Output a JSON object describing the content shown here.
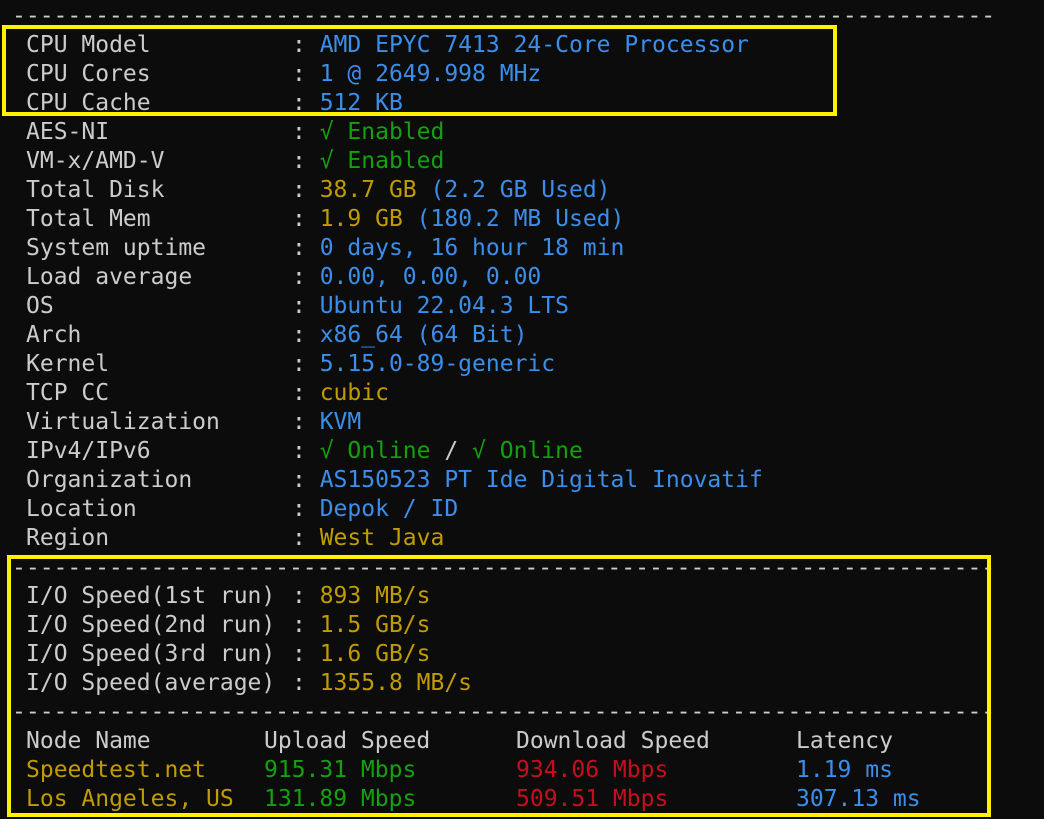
{
  "top_fragment": "‒ ,",
  "rule_text": "-----------------------------------------------------------------------------",
  "sysinfo": [
    {
      "label": "CPU Model",
      "value": "AMD EPYC 7413 24-Core Processor",
      "color": "blue"
    },
    {
      "label": "CPU Cores",
      "value": "1 @ 2649.998 MHz",
      "color": "blue"
    },
    {
      "label": "CPU Cache",
      "value": "512 KB",
      "color": "blue"
    },
    {
      "label": "AES-NI",
      "value": "√ Enabled",
      "color": "green"
    },
    {
      "label": "VM-x/AMD-V",
      "value": "√ Enabled",
      "color": "green"
    },
    {
      "label": "Total Disk",
      "value": "38.7 GB",
      "value2": "(2.2 GB Used)",
      "color": "gold",
      "color2": "blue"
    },
    {
      "label": "Total Mem",
      "value": "1.9 GB",
      "value2": "(180.2 MB Used)",
      "color": "gold",
      "color2": "blue"
    },
    {
      "label": "System uptime",
      "value": "0 days, 16 hour 18 min",
      "color": "blue"
    },
    {
      "label": "Load average",
      "value": "0.00, 0.00, 0.00",
      "color": "blue"
    },
    {
      "label": "OS",
      "value": "Ubuntu 22.04.3 LTS",
      "color": "blue"
    },
    {
      "label": "Arch",
      "value": "x86_64 (64 Bit)",
      "color": "blue"
    },
    {
      "label": "Kernel",
      "value": "5.15.0-89-generic",
      "color": "blue"
    },
    {
      "label": "TCP CC",
      "value": "cubic",
      "color": "gold"
    },
    {
      "label": "Virtualization",
      "value": "KVM",
      "color": "blue"
    },
    {
      "label": "IPv4/IPv6",
      "value": "√ Online",
      "value_sep": " / ",
      "value2": "√ Online",
      "color": "green",
      "color2": "green"
    },
    {
      "label": "Organization",
      "value": "AS150523 PT Ide Digital Inovatif",
      "color": "blue"
    },
    {
      "label": "Location",
      "value": "Depok / ID",
      "color": "blue"
    },
    {
      "label": "Region",
      "value": "West Java",
      "color": "gold"
    }
  ],
  "separator": ": ",
  "io": [
    {
      "label": "I/O Speed(1st run)",
      "value": "893 MB/s"
    },
    {
      "label": "I/O Speed(2nd run)",
      "value": "1.5 GB/s"
    },
    {
      "label": "I/O Speed(3rd run)",
      "value": "1.6 GB/s"
    },
    {
      "label": "I/O Speed(average)",
      "value": "1355.8 MB/s"
    }
  ],
  "speedtest": {
    "headers": [
      "Node Name",
      "Upload Speed",
      "Download Speed",
      "Latency"
    ],
    "rows": [
      [
        "Speedtest.net",
        "915.31 Mbps",
        "934.06 Mbps",
        "1.19 ms"
      ],
      [
        "Los Angeles, US",
        "131.89 Mbps",
        "509.51 Mbps",
        "307.13 ms"
      ]
    ]
  },
  "colors": {
    "background": "#0c0c0c",
    "text": "#cccccc",
    "blue": "#3b8eea",
    "green": "#13a10e",
    "gold": "#c19c00",
    "red": "#c50f1f",
    "highlight": "#fff200"
  }
}
